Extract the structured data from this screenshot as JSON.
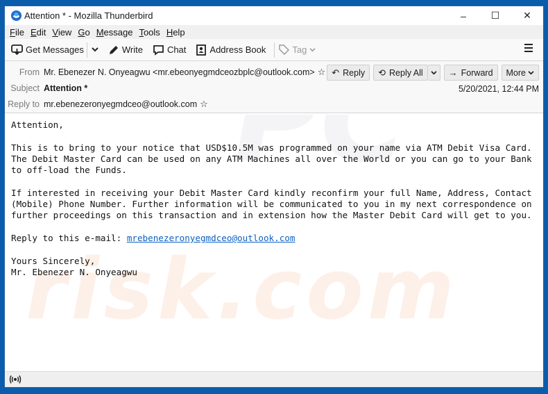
{
  "window": {
    "title": "Attention * - Mozilla Thunderbird",
    "controls": {
      "minimize": "–",
      "maximize": "☐",
      "close": "✕"
    }
  },
  "menubar": {
    "items": [
      {
        "key": "F",
        "rest": "ile"
      },
      {
        "key": "E",
        "rest": "dit"
      },
      {
        "key": "V",
        "rest": "iew"
      },
      {
        "key": "G",
        "rest": "o"
      },
      {
        "key": "M",
        "rest": "essage"
      },
      {
        "key": "T",
        "rest": "ools"
      },
      {
        "key": "H",
        "rest": "elp"
      }
    ]
  },
  "toolbar": {
    "get_messages": "Get Messages",
    "write": "Write",
    "chat": "Chat",
    "address_book": "Address Book",
    "tag": "Tag"
  },
  "header": {
    "from_label": "From",
    "from_value": "Mr. Ebenezer N. Onyeagwu <mr.ebeonyegmdceozbplc@outlook.com>",
    "subject_label": "Subject",
    "subject_value": "Attention *",
    "replyto_label": "Reply to",
    "replyto_value": "mr.ebenezeronyegmdceo@outlook.com",
    "date": "5/20/2021, 12:44 PM",
    "buttons": {
      "reply": "Reply",
      "reply_all": "Reply All",
      "forward": "Forward",
      "more": "More"
    }
  },
  "message": {
    "greeting": "Attention,",
    "para1": "This is to bring to your notice that USD$10.5M was programmed on your name via ATM Debit Visa Card.\nThe Debit Master Card can be used on any ATM Machines all over the World or you can go to your Bank\nto off-load the Funds.",
    "para2": "If interested in receiving your Debit Master Card kindly reconfirm your full Name, Address, Contact\n(Mobile) Phone Number. Further information will be communicated to you in my next correspondence on\nfurther proceedings on this transaction and in extension how the Master Debit Card will get to you.",
    "reply_prefix": "Reply to this e-mail: ",
    "reply_link": "mrebenezeronyegmdceo@outlook.com",
    "closing": "Yours Sincerely,\nMr. Ebenezer N. Onyeagwu"
  },
  "watermark": {
    "line1": "risk.com",
    "line2": "PC"
  }
}
